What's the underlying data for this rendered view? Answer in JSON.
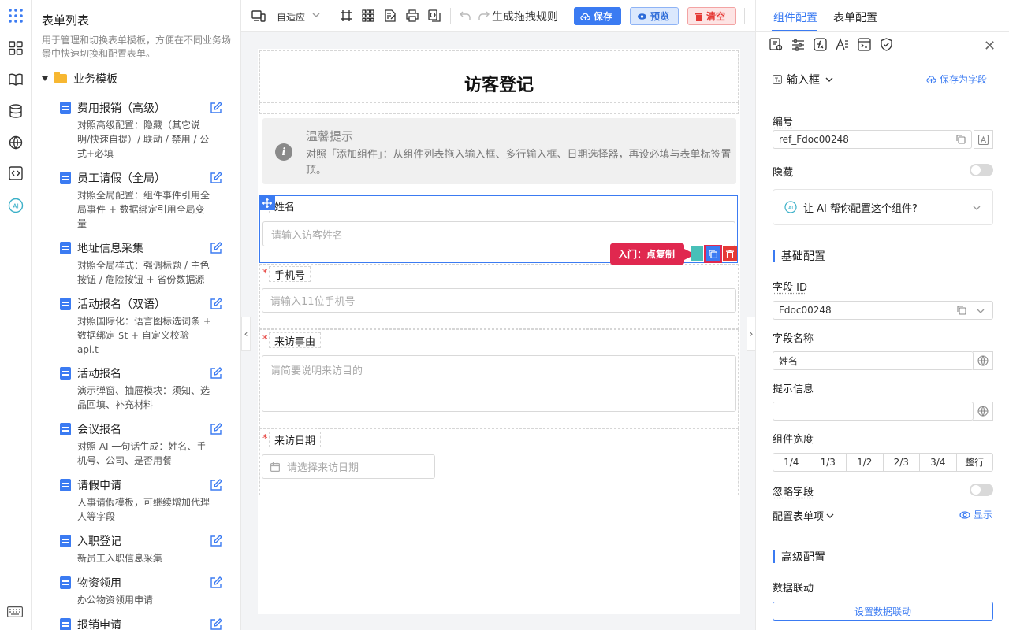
{
  "colors": {
    "primary": "#3b7bf2",
    "danger": "#e53935",
    "callout": "#e0284f",
    "folder": "#f7b731"
  },
  "rail": {
    "icons": [
      "apps-grid-icon",
      "components-icon",
      "book-icon",
      "database-icon",
      "globe-icon",
      "code-icon",
      "ai-icon",
      "keyboard-icon"
    ],
    "ai_label": "AI"
  },
  "sidebar": {
    "title": "表单列表",
    "description": "用于管理和切换表单模板，方便在不同业务场景中快速切换和配置表单。",
    "group": "业务模板",
    "items": [
      {
        "name": "费用报销（高级）",
        "desc": "对照高级配置：隐藏（其它说明/快速自提）/ 联动 / 禁用 / 公式+必填"
      },
      {
        "name": "员工请假（全局）",
        "desc": "对照全局配置：组件事件引用全局事件 + 数据绑定引用全局变量"
      },
      {
        "name": "地址信息采集",
        "desc": "对照全局样式：强调标题 / 主色按钮 / 危险按钮 + 省份数据源"
      },
      {
        "name": "活动报名（双语）",
        "desc": "对照国际化：语言图标选词条 + 数据绑定 $t + 自定义校验 api.t"
      },
      {
        "name": "活动报名",
        "desc": "演示弹窗、抽屉模块：须知、选品回填、补充材料"
      },
      {
        "name": "会议报名",
        "desc": "对照 AI 一句话生成：姓名、手机号、公司、是否用餐"
      },
      {
        "name": "请假申请",
        "desc": "人事请假模板，可继续增加代理人等字段"
      },
      {
        "name": "入职登记",
        "desc": "新员工入职信息采集"
      },
      {
        "name": "物资领用",
        "desc": "办公物资领用申请"
      },
      {
        "name": "报销申请",
        "desc": ""
      }
    ]
  },
  "toolbar": {
    "mode": "自适应",
    "rules_label": "生成拖拽规则",
    "save_label": "保存",
    "preview_label": "预览",
    "clear_label": "清空"
  },
  "form": {
    "title": "访客登记",
    "tip_title": "温馨提示",
    "tip_text": "对照「添加组件」：从组件列表拖入输入框、多行输入框、日期选择器，再设必填与表单标签置顶。",
    "fields": [
      {
        "label": "姓名",
        "placeholder": "请输入访客姓名",
        "required": false
      },
      {
        "label": "手机号",
        "placeholder": "请输入11位手机号",
        "required": true
      },
      {
        "label": "来访事由",
        "placeholder": "请简要说明来访目的",
        "required": true
      },
      {
        "label": "来访日期",
        "placeholder": "请选择来访日期",
        "required": true
      }
    ],
    "required_mark": "*",
    "callout": "入门：点复制"
  },
  "panel": {
    "tabs": [
      "组件配置",
      "表单配置"
    ],
    "component_type": "输入框",
    "save_as_field": "保存为字段",
    "code_label": "编号",
    "code_value": "ref_Fdoc00248",
    "hidden_label": "隐藏",
    "ai_prompt": "让 AI 帮你配置这个组件?",
    "basic_title": "基础配置",
    "field_id_label": "字段 ID",
    "field_id_value": "Fdoc00248",
    "field_name_label": "字段名称",
    "field_name_value": "姓名",
    "hint_label": "提示信息",
    "hint_value": "",
    "width_label": "组件宽度",
    "widths": [
      "1/4",
      "1/3",
      "1/2",
      "2/3",
      "3/4",
      "整行"
    ],
    "ignore_label": "忽略字段",
    "form_items_label": "配置表单项",
    "show_label": "显示",
    "advanced_title": "高级配置",
    "linkage_label": "数据联动",
    "linkage_button": "设置数据联动"
  }
}
